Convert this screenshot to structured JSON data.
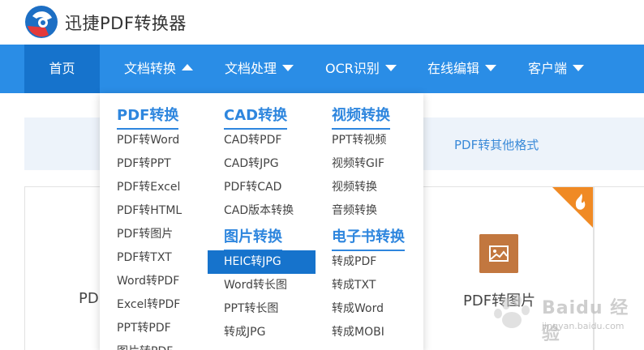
{
  "app": {
    "brand": "迅捷PDF转换器"
  },
  "nav": {
    "items": [
      {
        "label": "首页"
      },
      {
        "label": "文档转换"
      },
      {
        "label": "文档处理"
      },
      {
        "label": "OCR识别"
      },
      {
        "label": "在线编辑"
      },
      {
        "label": "客户端"
      }
    ]
  },
  "band": {
    "link": "PDF转其他格式"
  },
  "cards": {
    "left_label": "PD",
    "right_label": "PDF转图片"
  },
  "watermark": {
    "brand": "Baidu 经验",
    "url": "jingyan.baidu.com"
  },
  "dropdown": {
    "columns": [
      {
        "title": "PDF转换",
        "items": [
          "PDF转Word",
          "PDF转PPT",
          "PDF转Excel",
          "PDF转HTML",
          "PDF转图片",
          "PDF转TXT",
          "Word转PDF",
          "Excel转PDF",
          "PPT转PDF",
          "图片转PDF"
        ]
      },
      {
        "title": "CAD转换",
        "items": [
          "CAD转PDF",
          "CAD转JPG",
          "PDF转CAD",
          "CAD版本转换"
        ]
      },
      {
        "title": "图片转换",
        "items": [
          "HEIC转JPG",
          "Word转长图",
          "PPT转长图",
          "转成JPG"
        ]
      },
      {
        "title": "视频转换",
        "items": [
          "PPT转视频",
          "视频转GIF",
          "视频转换",
          "音频转换"
        ]
      },
      {
        "title": "电子书转换",
        "items": [
          "转成PDF",
          "转成TXT",
          "转成Word",
          "转成MOBI"
        ]
      }
    ]
  },
  "colors": {
    "nav_bg": "#2a8de6",
    "nav_active": "#1673cc",
    "accent": "#2e86de",
    "badge": "#f08a24",
    "pic_icon": "#c2773f"
  }
}
